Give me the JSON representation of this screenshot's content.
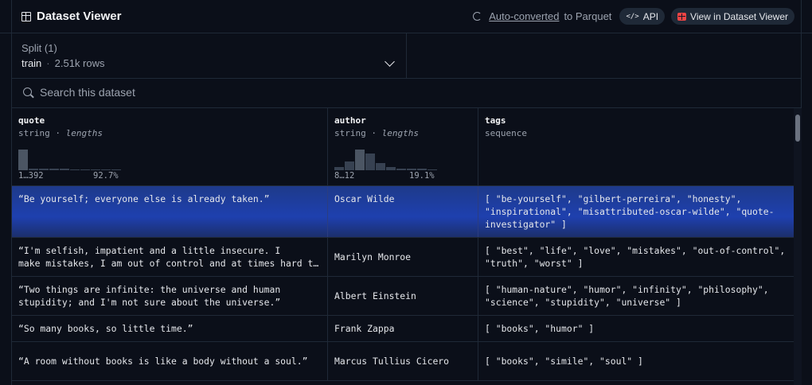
{
  "header": {
    "title": "Dataset Viewer",
    "auto_converted_link": "Auto-converted",
    "to_parquet": "to Parquet",
    "api_label": "API",
    "view_label": "View in Dataset Viewer"
  },
  "split": {
    "label": "Split (1)",
    "name": "train",
    "separator": "·",
    "rows": "2.51k rows"
  },
  "search": {
    "placeholder": "Search this dataset"
  },
  "columns": [
    {
      "name": "quote",
      "type": "string",
      "sep": " · ",
      "stat": "lengths",
      "range": "1…392",
      "pct": "92.7%",
      "histogram": [
        0.86,
        0.08,
        0.06,
        0.06,
        0.05,
        0.04,
        0.03,
        0.02,
        0.02,
        0.01
      ]
    },
    {
      "name": "author",
      "type": "string",
      "sep": " · ",
      "stat": "lengths",
      "range": "8…12",
      "pct": "19.1%",
      "histogram": [
        0.12,
        0.38,
        0.86,
        0.71,
        0.3,
        0.12,
        0.08,
        0.06,
        0.05,
        0.04
      ]
    },
    {
      "name": "tags",
      "type": "sequence"
    }
  ],
  "rows": [
    {
      "quote": "“Be yourself; everyone else is already taken.”",
      "author": "Oscar Wilde",
      "tags": "[ \"be-yourself\", \"gilbert-perreira\", \"honesty\", \"inspirational\", \"misattributed-oscar-wilde\", \"quote-investigator\" ]"
    },
    {
      "quote_line1": "“I'm selfish, impatient and a little insecure. I",
      "quote_line2": "make mistakes, I am out of control and at times hard to handle.",
      "author": "Marilyn Monroe",
      "tags": "[ \"best\", \"life\", \"love\", \"mistakes\", \"out-of-control\", \"truth\", \"worst\" ]"
    },
    {
      "quote": "“Two things are infinite: the universe and human stupidity; and I'm not sure about the universe.”",
      "author": "Albert Einstein",
      "tags": "[ \"human-nature\", \"humor\", \"infinity\", \"philosophy\", \"science\", \"stupidity\", \"universe\" ]"
    },
    {
      "quote": "“So many books, so little time.”",
      "author": "Frank Zappa",
      "tags": "[ \"books\", \"humor\" ]"
    },
    {
      "quote": "“A room without books is like a body without a soul.”",
      "author": "Marcus Tullius Cicero",
      "tags": "[ \"books\", \"simile\", \"soul\" ]"
    }
  ]
}
